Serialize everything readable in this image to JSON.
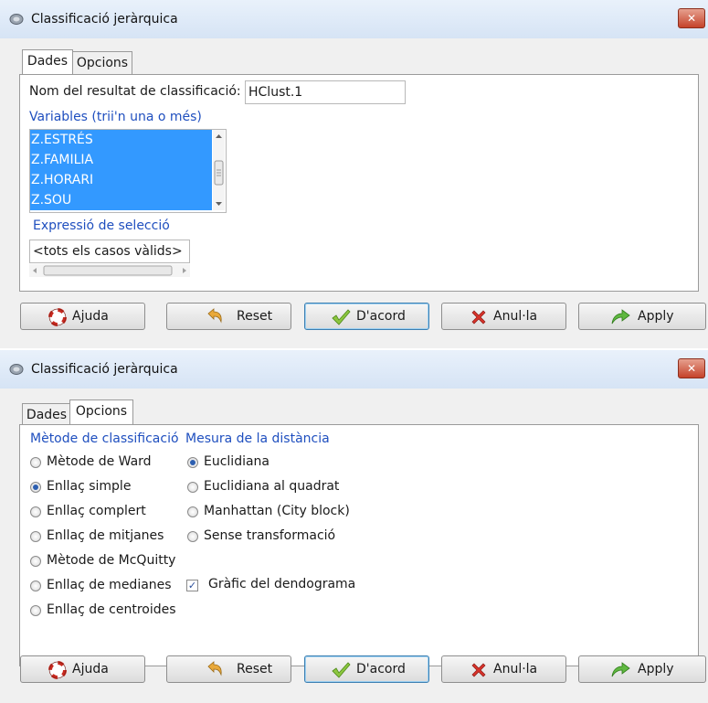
{
  "window1": {
    "title": "Classificació jeràrquica",
    "close_glyph": "✕",
    "tabs": [
      "Dades",
      "Opcions"
    ],
    "result_name_label": "Nom del resultat de classificació:",
    "result_name_value": "HClust.1",
    "variables_label": "Variables (trii'n una o més)",
    "variables": [
      "Z.ESTRÉS",
      "Z.FAMILIA",
      "Z.HORARI",
      "Z.SOU"
    ],
    "selection_label": "Expressió de selecció",
    "selection_value": "<tots els casos vàlids>",
    "buttons": {
      "help": "Ajuda",
      "reset": "Reset",
      "ok": "D'acord",
      "cancel": "Anul·la",
      "apply": "Apply"
    }
  },
  "window2": {
    "title": "Classificació jeràrquica",
    "close_glyph": "✕",
    "tabs": [
      "Dades",
      "Opcions"
    ],
    "method_header": "Mètode de classificació",
    "distance_header": "Mesura de la distància",
    "methods": [
      {
        "label": "Mètode de Ward",
        "selected": false
      },
      {
        "label": "Enllaç simple",
        "selected": true
      },
      {
        "label": "Enllaç complert",
        "selected": false
      },
      {
        "label": "Enllaç de mitjanes",
        "selected": false
      },
      {
        "label": "Mètode de McQuitty",
        "selected": false
      },
      {
        "label": "Enllaç de medianes",
        "selected": false
      },
      {
        "label": "Enllaç de centroides",
        "selected": false
      }
    ],
    "distances": [
      {
        "label": "Euclidiana",
        "selected": true
      },
      {
        "label": "Euclidiana al quadrat",
        "selected": false
      },
      {
        "label": "Manhattan (City block)",
        "selected": false
      },
      {
        "label": "Sense transformació",
        "selected": false
      }
    ],
    "dendrogram_checkbox": {
      "label": "Gràfic del dendograma",
      "checked": true,
      "mark": "✓"
    },
    "buttons": {
      "help": "Ajuda",
      "reset": "Reset",
      "ok": "D'acord",
      "cancel": "Anul·la",
      "apply": "Apply"
    }
  },
  "icons": [
    "window-icon",
    "lifebuoy-icon",
    "undo-arrow-icon",
    "checkmark-icon",
    "red-x-icon",
    "green-arrow-icon"
  ],
  "colors": {
    "label_blue": "#1f4fbf",
    "selection": "#3399ff",
    "close_red": "#c5432a"
  }
}
